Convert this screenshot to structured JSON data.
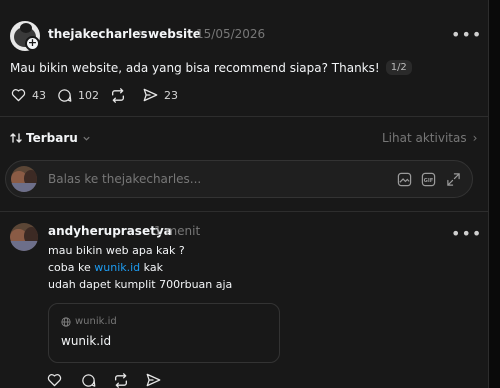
{
  "post": {
    "username": "thejakecharles",
    "separator": "›",
    "topic": "website",
    "date": "15/05/2026",
    "text": "Mau bikin website, ada yang bisa recommend siapa? Thanks!",
    "page_indicator": "1/2",
    "likes": "43",
    "comments": "102",
    "shares": "23"
  },
  "sort": {
    "label": "Terbaru",
    "activity_link": "Lihat aktivitas",
    "activity_chevron": "›"
  },
  "reply": {
    "placeholder": "Balas ke thejakecharles..."
  },
  "comment": {
    "username": "andyheruprasetya",
    "time": "1 menit",
    "line1": "mau bikin web apa kak ?",
    "line2_prefix": "coba ke ",
    "line2_link": "wunik.id",
    "line2_suffix": " kak",
    "line3": "udah dapet kumplit 700rbuan aja",
    "card_domain": "wunik.id",
    "card_title": "wunik.id"
  },
  "colors": {
    "background": "#181818",
    "link": "#1d9bf0",
    "muted": "#777777"
  }
}
